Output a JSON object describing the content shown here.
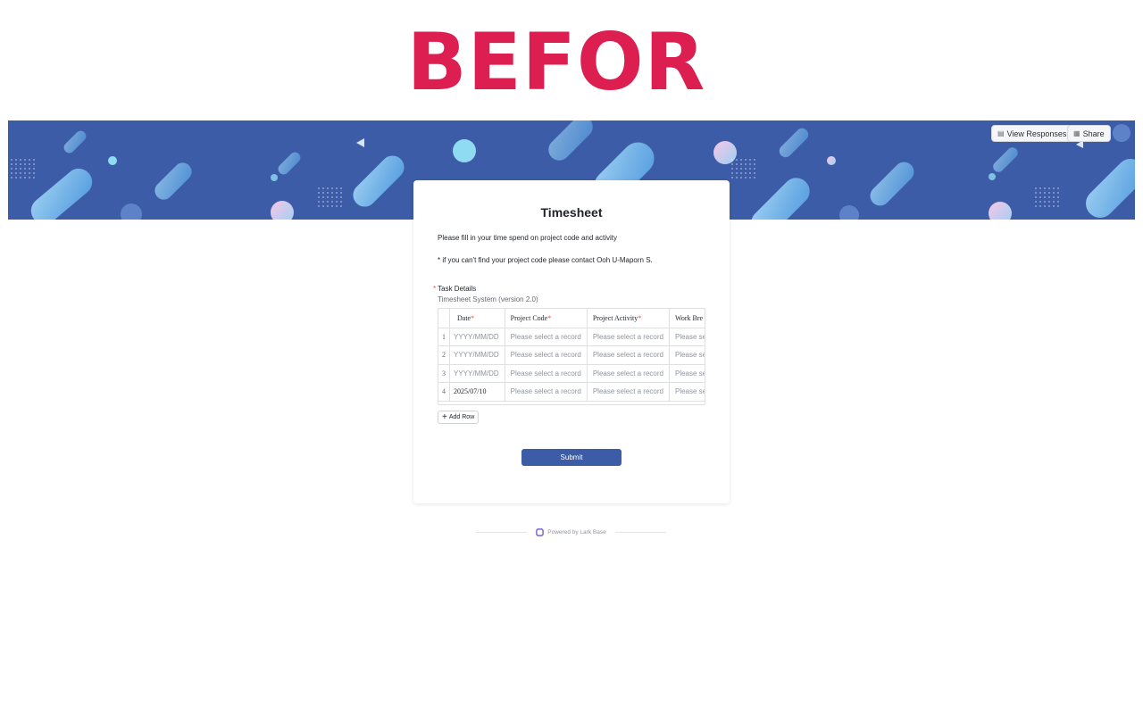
{
  "overlay_title": "BEFOR",
  "header": {
    "view_responses_label": "View Responses",
    "share_label": "Share"
  },
  "form": {
    "title": "Timesheet",
    "description_line1": "Please fill in your time spend on project code and activity",
    "description_line2": "* if you can't find your project code please contact Ooh U-Maporn S.",
    "field_label": "Task Details",
    "field_required_mark": "*",
    "field_subtitle": "Timesheet System (version 2.0)",
    "table": {
      "columns": [
        "Date",
        "Project Code",
        "Project Activity",
        "Work Bre"
      ],
      "required_mark": "*",
      "rows": [
        {
          "num": "1",
          "date": "YYYY/MM/DD",
          "code": "Please select a record",
          "activity": "Please select a record",
          "work": "Please se"
        },
        {
          "num": "2",
          "date": "YYYY/MM/DD",
          "code": "Please select a record",
          "activity": "Please select a record",
          "work": "Please se"
        },
        {
          "num": "3",
          "date": "YYYY/MM/DD",
          "code": "Please select a record",
          "activity": "Please select a record",
          "work": "Please se"
        },
        {
          "num": "4",
          "date": "2025/07/10",
          "code": "Please select a record",
          "activity": "Please select a record",
          "work": "Please se"
        }
      ]
    },
    "add_row_label": "Add Row",
    "submit_label": "Submit"
  },
  "footer": {
    "powered_by": "Powered by Lark Base"
  },
  "colors": {
    "brand_blue": "#3c5ca8",
    "overlay_red": "#dc1f50",
    "required_red": "#f54a45"
  }
}
